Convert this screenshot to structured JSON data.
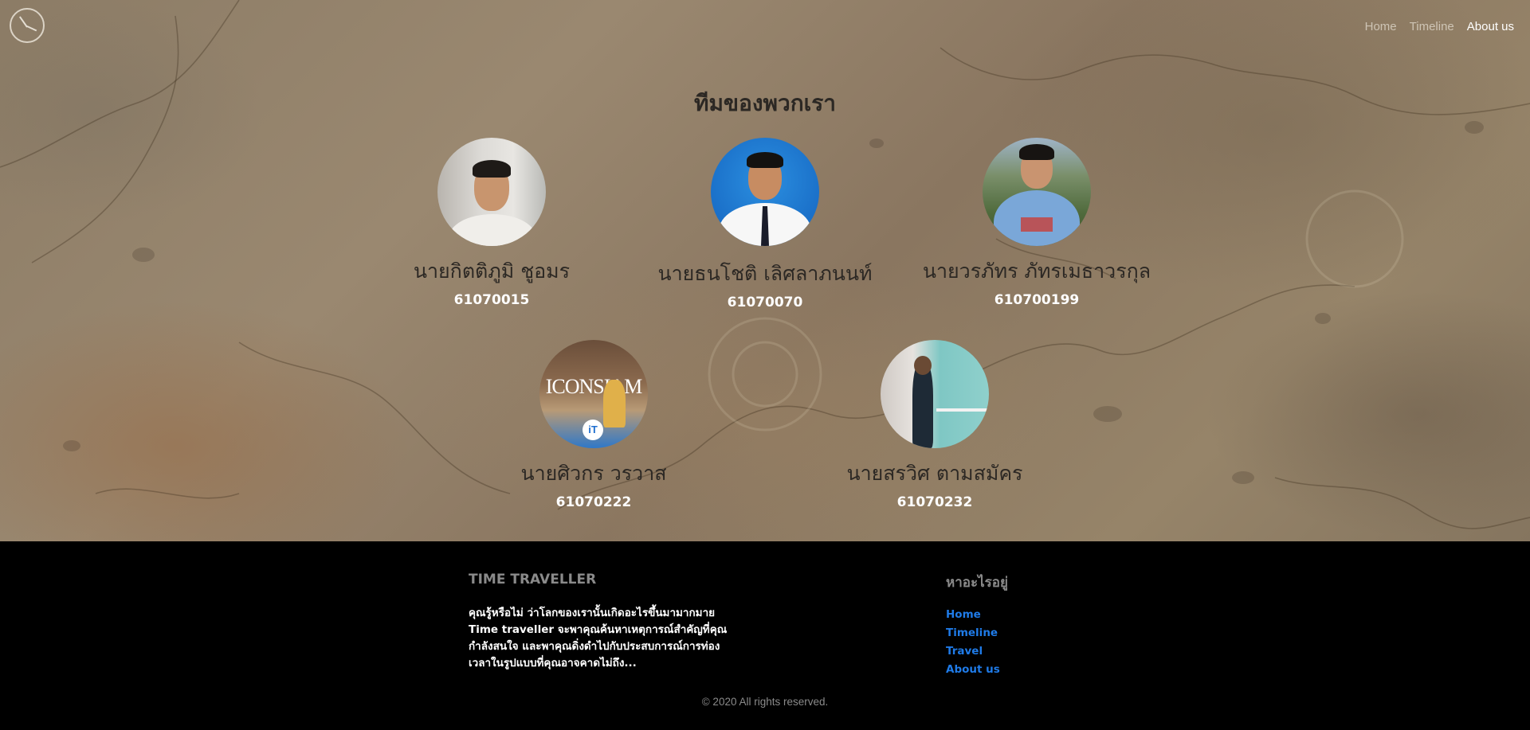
{
  "header": {
    "logo_icon": "clock-compass-icon",
    "nav": [
      {
        "label": "Home",
        "active": false
      },
      {
        "label": "Timeline",
        "active": false
      },
      {
        "label": "About us",
        "active": true
      }
    ]
  },
  "team": {
    "title": "ทีมของพวกเรา",
    "members": [
      {
        "name": "นายกิตติภูมิ ชูอมร",
        "id": "61070015"
      },
      {
        "name": "นายธนโชติ เลิศลาภนนท์",
        "id": "61070070"
      },
      {
        "name": "นายวรภัทร ภัทรเมธาวรกุล",
        "id": "610700199"
      },
      {
        "name": "นายศิวกร วรวาส",
        "id": "61070222",
        "avatar_text": "ICONSIAM",
        "badge": "iT"
      },
      {
        "name": "นายสรวิศ ตามสมัคร",
        "id": "61070232"
      }
    ]
  },
  "footer": {
    "brand": "TIME TRAVELLER",
    "description_lines": [
      "คุณรู้หรือไม่ ว่าโลกของเรานั้นเกิดอะไรขึ้นมามากมาย",
      "Time traveller จะพาคุณค้นหาเหตุการณ์สำคัญที่คุณ",
      "กำลังสนใจ และพาคุณดิ่งดำไปกับประสบการณ์การท่อง",
      "เวลาในรูปแบบที่คุณอาจคาดไม่ถึง..."
    ],
    "links_title": "หาอะไรอยู่",
    "links": [
      "Home",
      "Timeline",
      "Travel",
      "About us"
    ],
    "copyright": "© 2020 All rights reserved."
  },
  "colors": {
    "link": "#1f7be8",
    "footer_bg": "#000000",
    "heading_text": "#2c2824",
    "id_text": "#ffffff"
  }
}
